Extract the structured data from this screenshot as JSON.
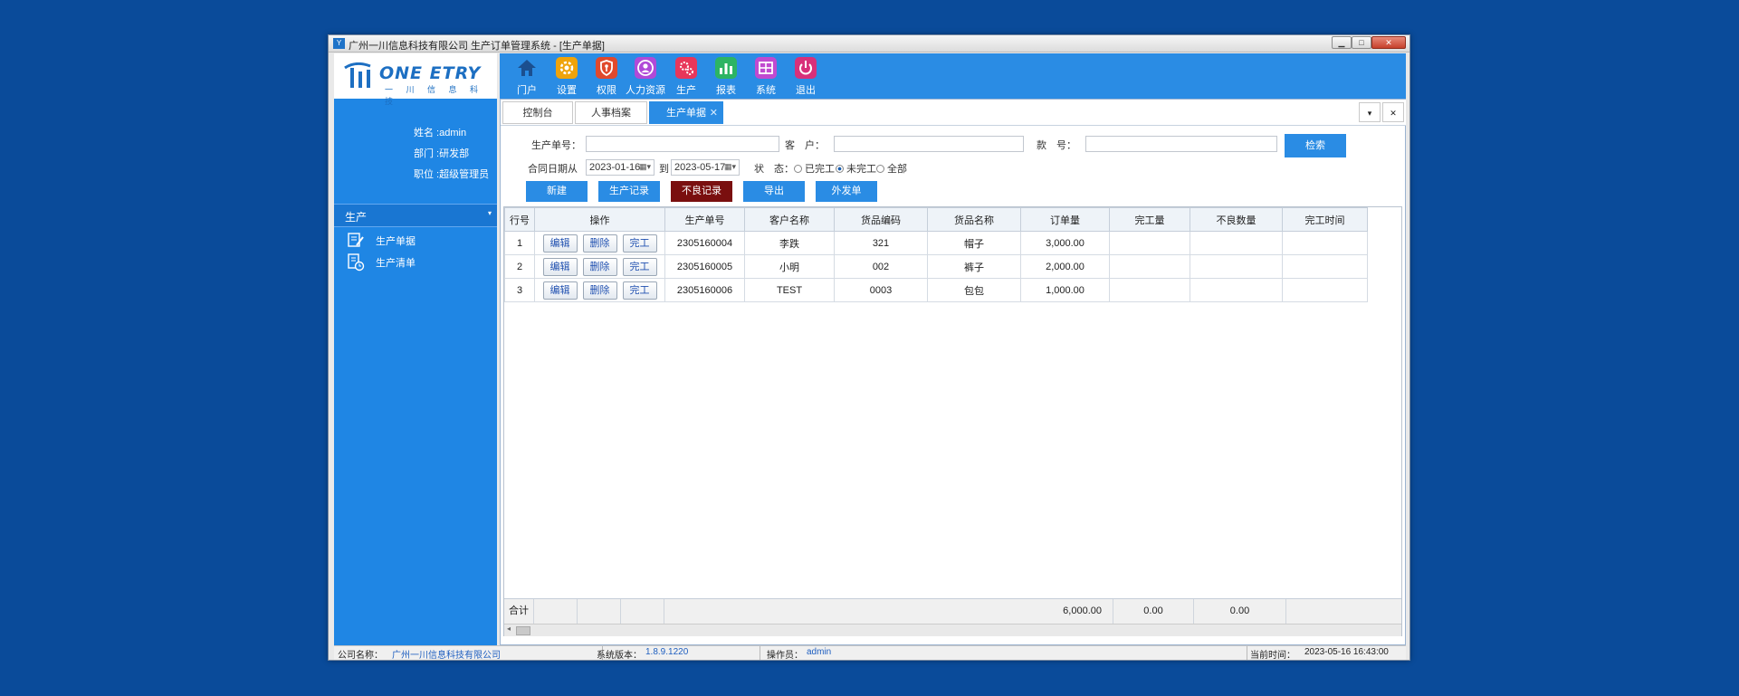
{
  "window": {
    "title": "广州一川信息科技有限公司 生产订单管理系统 - [生产单据]",
    "min": "▁",
    "max": "□",
    "close": "✕"
  },
  "logo": {
    "brand": "ONE ETRY",
    "subtitle": "一 川 信 息 科 技"
  },
  "user": {
    "name": "姓名 :admin",
    "dept": "部门 :研发部",
    "position": "职位 :超级管理员"
  },
  "sidebar": {
    "group": "生产",
    "items": [
      {
        "label": "生产单据",
        "icon": "document-edit-icon"
      },
      {
        "label": "生产清单",
        "icon": "list-clock-icon"
      }
    ]
  },
  "toolbar": {
    "buttons": [
      {
        "label": "门户",
        "icon": "home-icon",
        "color": "#1b4f8f"
      },
      {
        "label": "设置",
        "icon": "gear-icon",
        "color": "#f0a30a"
      },
      {
        "label": "权限",
        "icon": "shield-key-icon",
        "color": "#e0492c"
      },
      {
        "label": "人力资源",
        "icon": "person-icon",
        "color": "#b04ad8"
      },
      {
        "label": "生产",
        "icon": "gears-icon",
        "color": "#e8365a"
      },
      {
        "label": "报表",
        "icon": "bar-chart-icon",
        "color": "#2cb463"
      },
      {
        "label": "系统",
        "icon": "window-grid-icon",
        "color": "#c04ad0"
      },
      {
        "label": "退出",
        "icon": "power-icon",
        "color": "#d8307a"
      }
    ]
  },
  "tabs": [
    {
      "label": "控制台",
      "active": false
    },
    {
      "label": "人事档案",
      "active": false
    },
    {
      "label": "生产单据",
      "active": true
    }
  ],
  "filters": {
    "order_no_label": "生产单号：",
    "order_no_value": "",
    "customer_label": "客　户：",
    "customer_value": "",
    "style_label": "款　号：",
    "style_value": "",
    "search_button": "检索",
    "date_label": "合同日期从",
    "date_from": "2023-01-16",
    "date_to_label": "到",
    "date_to": "2023-05-17",
    "status_label": "状　态：",
    "status_options": [
      "已完工",
      "未完工",
      "全部"
    ],
    "status_selected": "未完工"
  },
  "actions": {
    "new": "新建",
    "production_record": "生产记录",
    "defect_record": "不良记录",
    "export": "导出",
    "outsource": "外发单"
  },
  "table": {
    "columns": [
      "行号",
      "操作",
      "生产单号",
      "客户名称",
      "货品编码",
      "货品名称",
      "订单量",
      "完工量",
      "不良数量",
      "完工时间"
    ],
    "op_labels": [
      "编辑",
      "删除",
      "完工"
    ],
    "rows": [
      {
        "no": "1",
        "order": "2305160004",
        "customer": "李跌",
        "code": "321",
        "name": "帽子",
        "qty": "3,000.00",
        "done": "",
        "defect": "",
        "time": ""
      },
      {
        "no": "2",
        "order": "2305160005",
        "customer": "小明",
        "code": "002",
        "name": "裤子",
        "qty": "2,000.00",
        "done": "",
        "defect": "",
        "time": ""
      },
      {
        "no": "3",
        "order": "2305160006",
        "customer": "TEST",
        "code": "0003",
        "name": "包包",
        "qty": "1,000.00",
        "done": "",
        "defect": "",
        "time": ""
      }
    ],
    "footer": {
      "label": "合计",
      "qty": "6,000.00",
      "done": "0.00",
      "defect": "0.00"
    }
  },
  "status_bar": {
    "company_label": "公司名称：",
    "company": "广州一川信息科技有限公司",
    "version_label": "系统版本：",
    "version": "1.8.9.1220",
    "operator_label": "操作员：",
    "operator": "admin",
    "time_label": "当前时间：",
    "time": "2023-05-16 16:43:00"
  }
}
